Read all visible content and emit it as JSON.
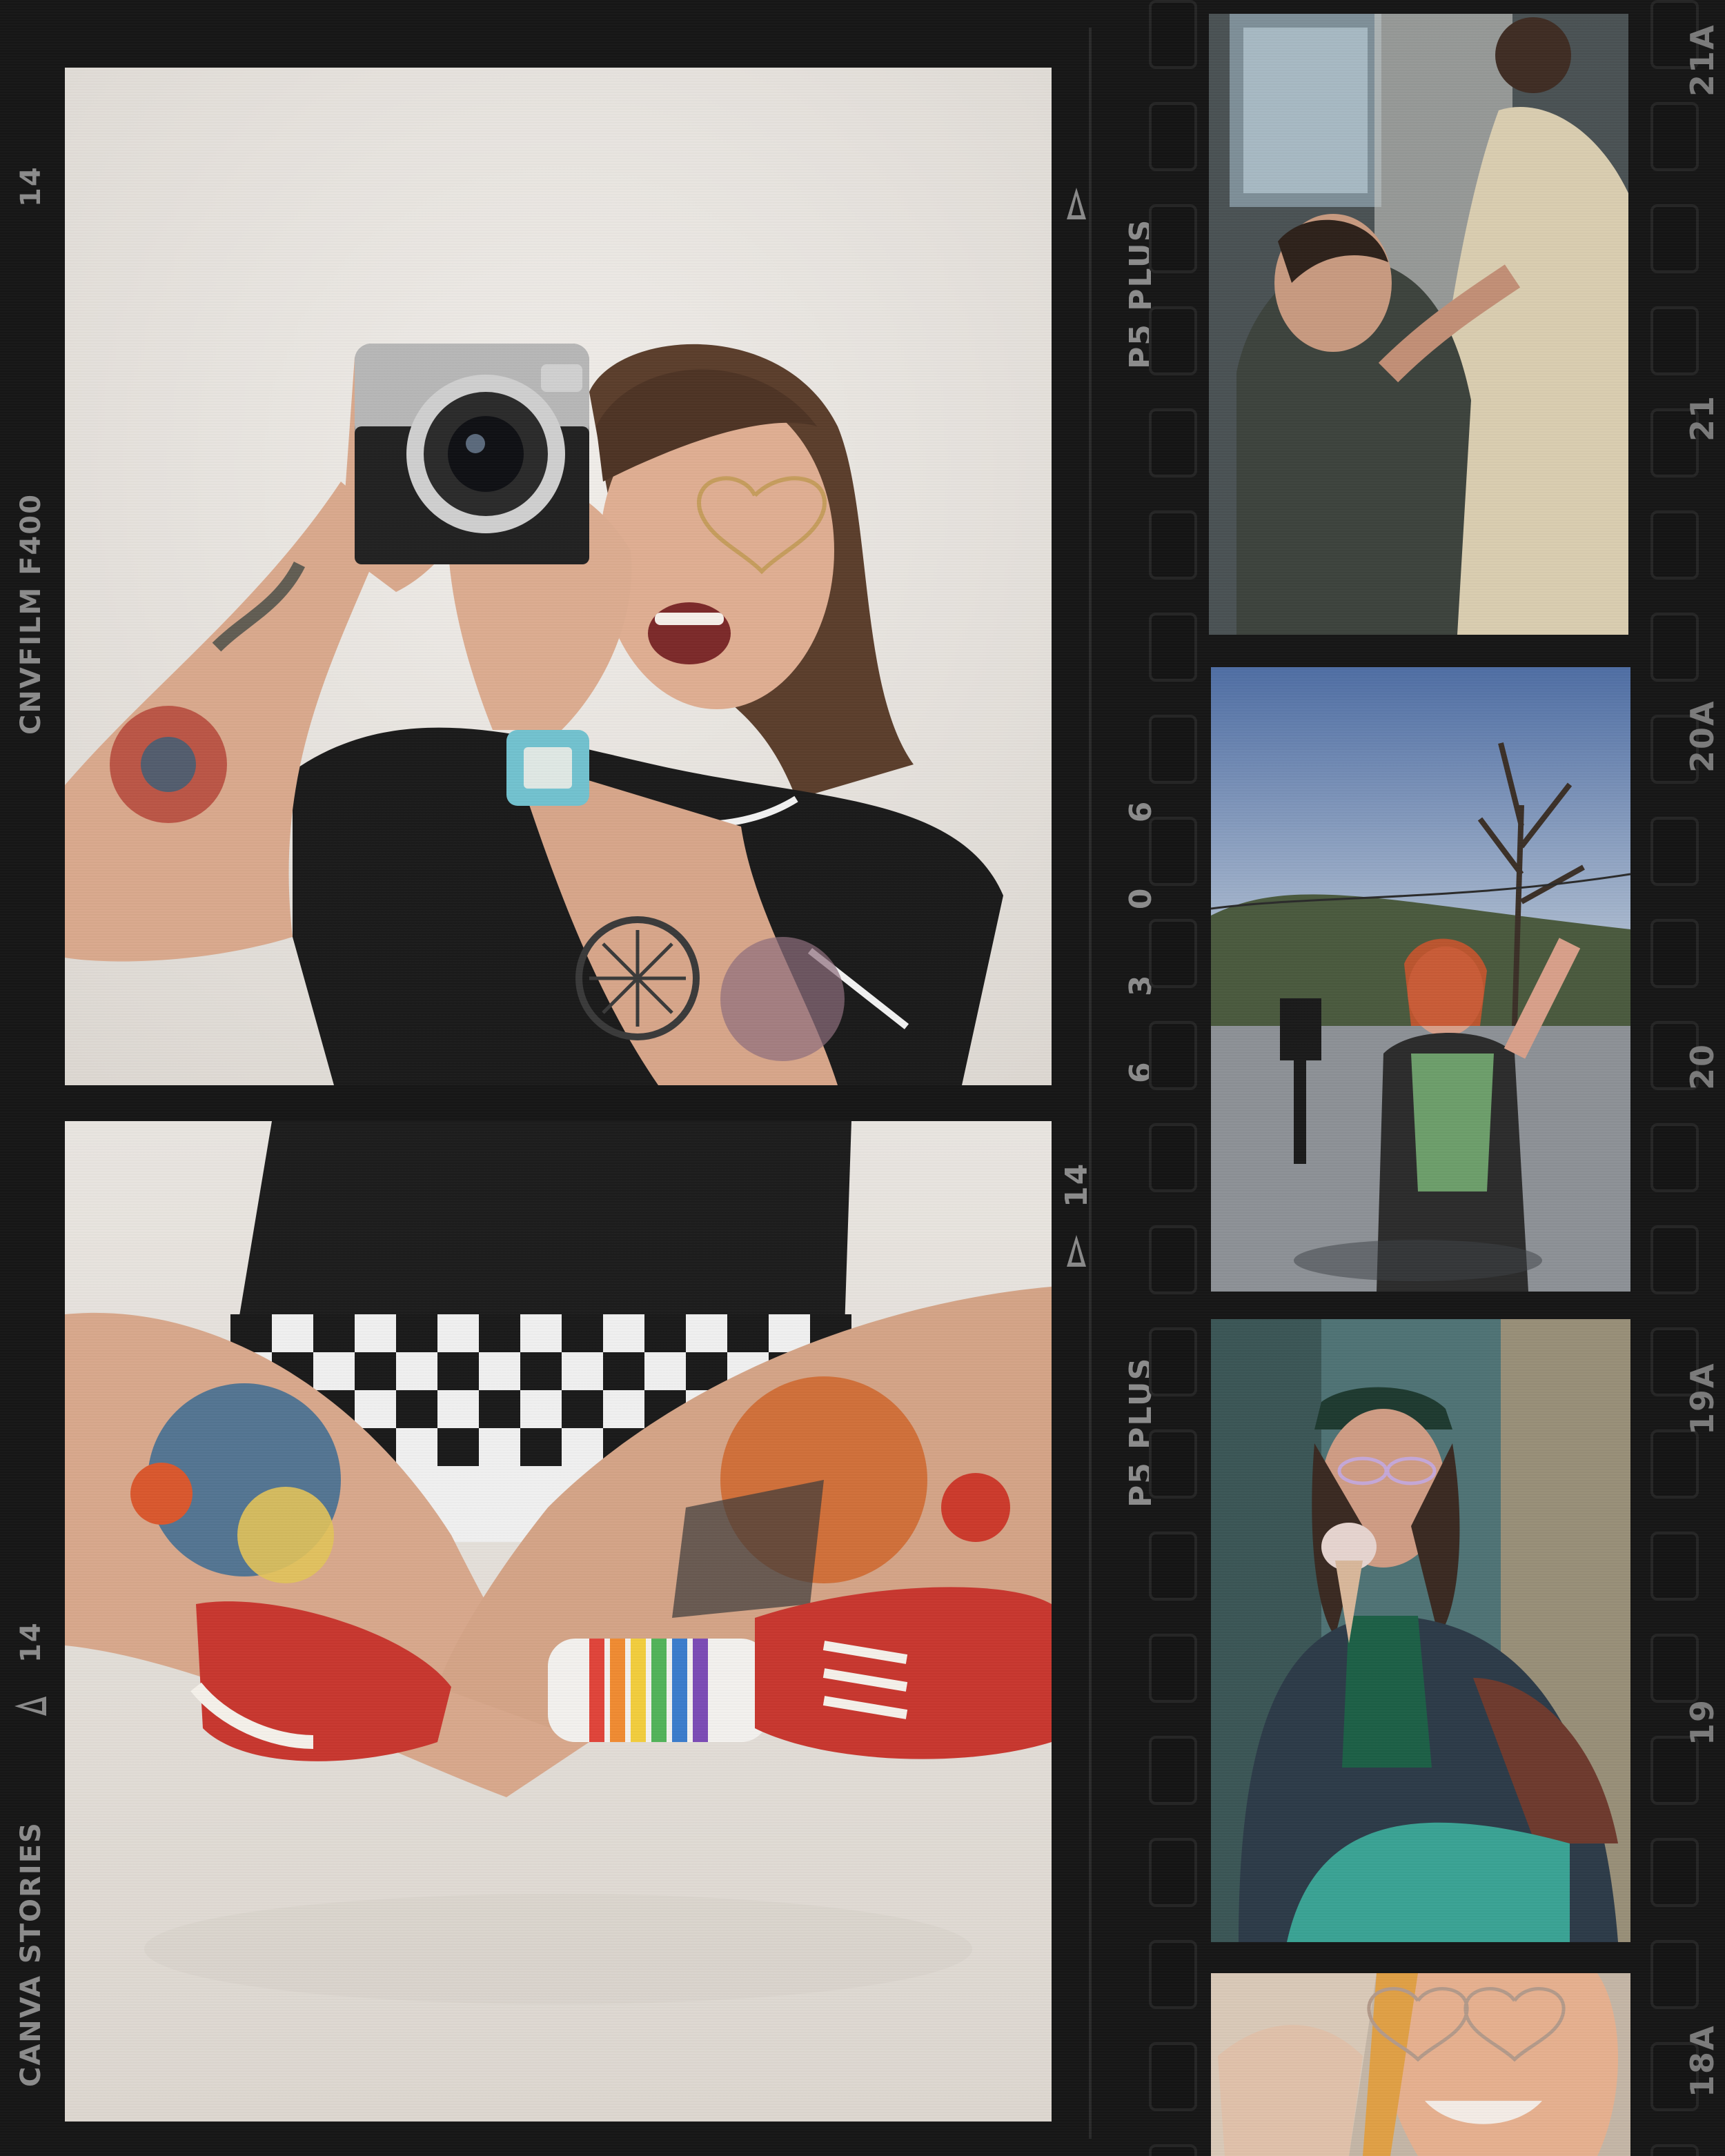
{
  "filmstrip": {
    "left_edge": {
      "frame_number": "14",
      "brand": "CNVFILM F400",
      "frame_number_2": "14",
      "credit": "CANVA STORIES"
    },
    "middle_edge": {
      "film_label_top": "P5 PLUS",
      "frame_number": "14",
      "code": "6 3 0 6",
      "film_label_bottom": "P5 PLUS"
    },
    "right_edge": {
      "frame_21": "21",
      "frame_21a": "21A",
      "frame_20": "20",
      "frame_20a": "20A",
      "frame_19": "19",
      "frame_19a": "19A",
      "frame_18a": "18A"
    }
  },
  "photos": {
    "main_top": "photographer-with-camera",
    "main_bottom": "crossed-legs-rainbow-socks",
    "thumb_1": "wedding-dress-fitting",
    "thumb_2": "gimbal-outdoor-cheer",
    "thumb_3": "ice-cream-portrait",
    "thumb_4": "heart-glasses-smile"
  },
  "colors": {
    "film_black": "#161616",
    "backdrop": "#e9e5e0",
    "shoe_red": "#c8372f",
    "skin": "#d9a98d"
  }
}
